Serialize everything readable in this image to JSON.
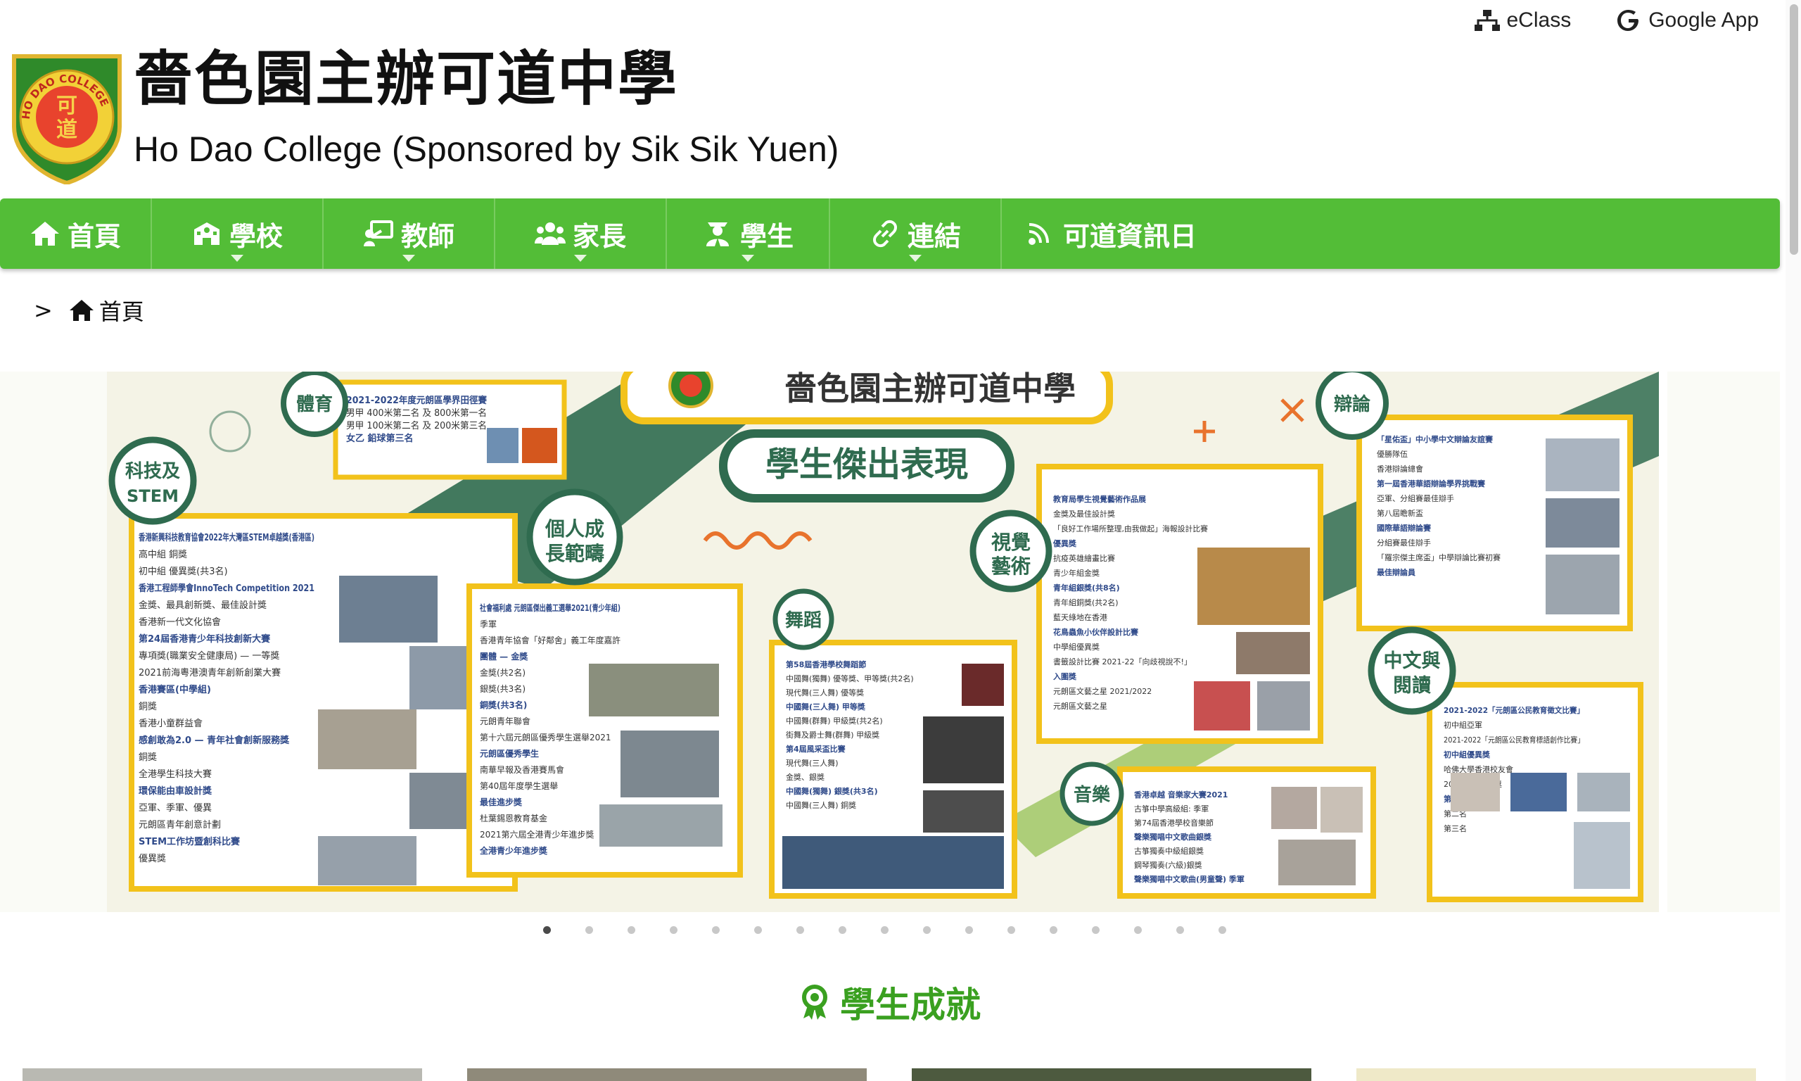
{
  "toplinks": [
    {
      "label": "eClass",
      "icon": "sitemap-icon"
    },
    {
      "label": "Google App",
      "icon": "google-g-icon"
    }
  ],
  "header": {
    "title_zh": "嗇色園主辦可道中學",
    "title_en": "Ho Dao College (Sponsored by Sik Sik Yuen)",
    "logo_text": "HO DAO COLLEGE"
  },
  "nav": [
    {
      "label": "首頁",
      "icon": "home-icon",
      "dropdown": false
    },
    {
      "label": "學校",
      "icon": "school-icon",
      "dropdown": true
    },
    {
      "label": "教師",
      "icon": "teacher-board-icon",
      "dropdown": true
    },
    {
      "label": "家長",
      "icon": "users-icon",
      "dropdown": true
    },
    {
      "label": "學生",
      "icon": "student-icon",
      "dropdown": true
    },
    {
      "label": "連結",
      "icon": "link-icon",
      "dropdown": true
    },
    {
      "label": "可道資訊日",
      "icon": "signal-icon",
      "dropdown": false
    }
  ],
  "breadcrumb": {
    "separator": ">",
    "home_label": "首頁"
  },
  "carousel": {
    "slide_count": 17,
    "active_index": 0,
    "slide": {
      "school_name": "嗇色園主辦可道中學",
      "heading": "學生傑出表現",
      "badges": [
        "體育",
        "科技及STEM",
        "個人成長範疇",
        "舞蹈",
        "視覺藝術",
        "音樂",
        "辯論",
        "中文與閱讀"
      ],
      "blocks": {
        "sport": [
          "2021-2022年度元朗區學界田徑賽",
          "男甲 400米第二名 及 800米第一名",
          "男甲 100米第二名 及 200米第三名",
          "女乙 鉛球第三名"
        ],
        "stem": [
          "香港新興科技教育協會2022年大灣區STEM卓越獎(香港區)",
          "高中組 銅獎",
          "初中組 優異獎(共3名)",
          "香港工程師學會InnoTech Competition 2021",
          "金獎、最具創新獎、最佳設計獎",
          "香港新一代文化協會",
          "第24屆香港青少年科技創新大賽",
          "專項獎(職業安全健康局) — 一等獎",
          "2021前海粵港澳青年創新創業大賽",
          "香港賽區(中學組)",
          "銅獎",
          "香港小童群益會",
          "感創敢為2.0 — 青年社會創新服務獎",
          "銅獎",
          "全港學生科技大賽",
          "環保能由車設計獎",
          "亞軍、季軍、優異",
          "元朗區青年創意計劃",
          "STEM工作坊暨創科比賽",
          "優異獎"
        ],
        "personal": [
          "社會福利處 元朗區傑出義工選舉2021(青少年組)",
          "季軍",
          "香港青年協會「好鄰舍」義工年度嘉許",
          "團體 — 金獎",
          "金獎(共2名)",
          "銀獎(共3名)",
          "銅獎(共3名)",
          "元朗青年聯會",
          "第十六屆元朗區優秀學生選舉2021",
          "元朗區優秀學生",
          "南華早報及香港賽馬會",
          "第40屆年度學生選舉",
          "最佳進步獎",
          "杜葉錫恩教育基金",
          "2021第六屆全港青少年進步獎",
          "全港青少年進步獎"
        ],
        "dance": [
          "第58屆香港學校舞蹈節",
          "中國舞(獨舞) 優等獎、甲等獎(共2名)",
          "現代舞(三人舞) 優等獎",
          "中國舞(三人舞) 甲等獎",
          "中國舞(群舞) 甲級獎(共2名)",
          "街舞及爵士舞(群舞) 甲級獎",
          "第4屆風采盃比賽",
          "現代舞(三人舞)",
          "金獎、銀獎",
          "中國舞(獨舞) 銀獎(共3名)",
          "中國舞(三人舞) 銅獎"
        ],
        "visual": [
          "教育局學生視覺藝術作品展",
          "金獎及最佳設計獎",
          "「良好工作場所整理,由我做起」海報設計比賽",
          "優異獎",
          "抗疫英雄繪畫比賽",
          "青少年組金獎",
          "青年組銀獎(共8名)",
          "青年組銅獎(共2名)",
          "藍天綠地在香港",
          "花鳥蟲魚小伙伴設計比賽",
          "中學組優異獎",
          "書籤設計比賽 2021-22「向歧視說不!」",
          "入圍獎",
          "元朗區文藝之星 2021/2022",
          "元朗區文藝之星"
        ],
        "music": [
          "香港卓越 音樂家大賽2021",
          "古箏中學高級組: 季軍",
          "第74屆香港學校音樂節",
          "聲樂獨唱中文歌曲銀獎",
          "古箏獨奏中級組銀獎",
          "鋼琴獨奏(六級)銀獎",
          "聲樂獨唱中文歌曲(男童聲) 季軍"
        ],
        "debate": [
          "「星佑盃」中小學中文辯論友誼賽",
          "優勝隊伍",
          "香港辯論總會",
          "第一屆香港華語辯論學界挑戰賽",
          "亞軍、分組賽最佳辯手",
          "第八屆瞻新盃",
          "國際華語辯論賽",
          "分組賽最佳辯手",
          "「羅宗傑主席盃」中學辯論比賽初賽",
          "最佳辯論員"
        ],
        "chinese": [
          "2021-2022「元朗區公民教育徵文比賽」",
          "初中組亞軍",
          "2021-2022「元朗區公民教育標語創作比賽」",
          "初中組優異獎",
          "哈佛大學香港校友會",
          "2022哈佛圖書獎",
          "第一名",
          "第二名",
          "第三名"
        ]
      }
    }
  },
  "section": {
    "title": "學生成就",
    "icon": "award-ribbon-icon"
  },
  "colors": {
    "nav_green": "#53bd37",
    "title_green": "#3aa020",
    "slide_green": "#2f6b4f",
    "slide_yellow": "#f2c21b",
    "slide_bg": "#f4f3e6"
  }
}
